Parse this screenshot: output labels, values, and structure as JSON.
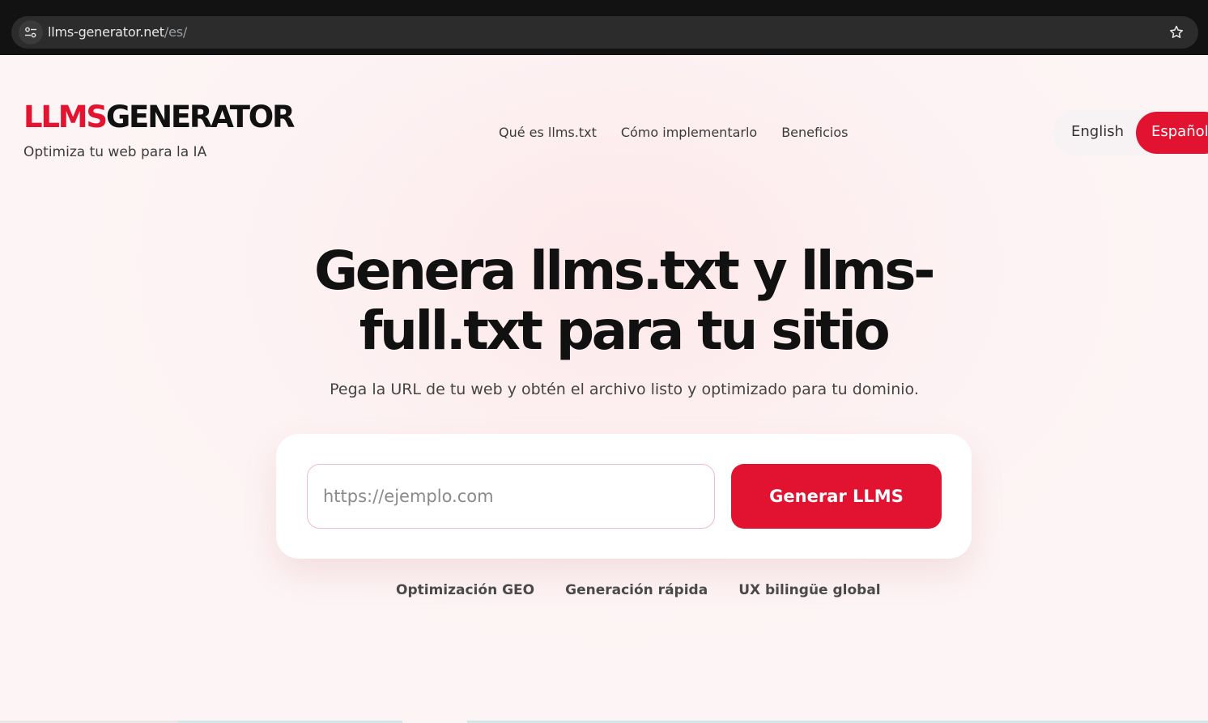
{
  "browser": {
    "url_host": "llms-generator.net",
    "url_path": "/es/"
  },
  "header": {
    "logo_red": "LLMS",
    "logo_dark": "GENERATOR",
    "tagline": "Optimiza tu web para la IA",
    "nav": [
      "Qué es llms.txt",
      "Cómo implementarlo",
      "Beneficios"
    ],
    "lang_en": "English",
    "lang_es": "Español"
  },
  "hero": {
    "title_line1": "Genera llms.txt y llms-",
    "title_line2": "full.txt para tu sitio",
    "subtitle": "Pega la URL de tu web y obtén el archivo listo y optimizado para tu dominio.",
    "input_placeholder": "https://ejemplo.com",
    "input_value": "",
    "button_label": "Generar LLMS"
  },
  "features": [
    "Optimización GEO",
    "Generación rápida",
    "UX bilingüe global"
  ],
  "colors": {
    "accent": "#e11330",
    "text": "#111111",
    "background": "#fdf2f3"
  }
}
